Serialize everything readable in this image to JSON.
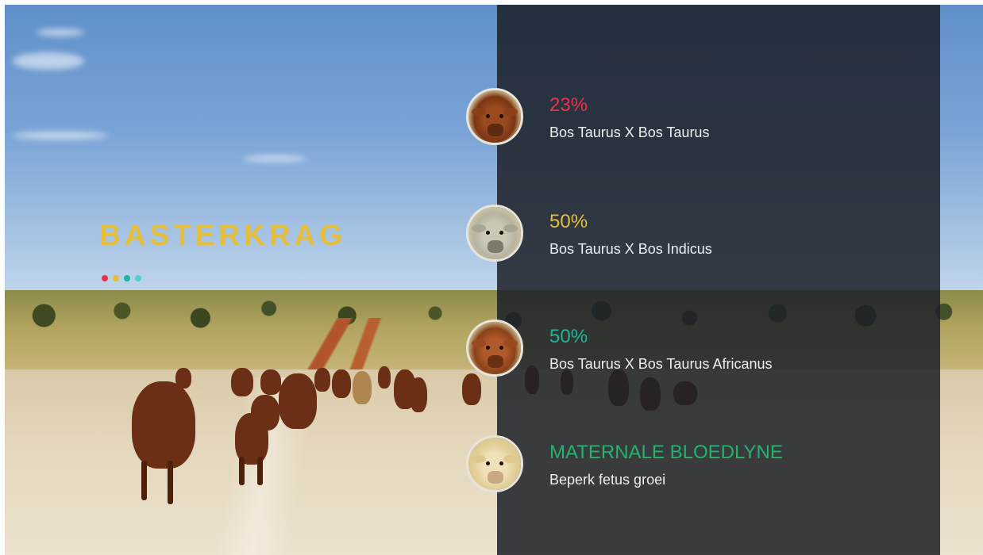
{
  "title": "BASTERKRAG",
  "dot_colors": [
    "#e8334f",
    "#e5bf3c",
    "#1fb39b",
    "#4dd2cf"
  ],
  "features": [
    {
      "value": "23%",
      "description": "Bos Taurus X  Bos Taurus",
      "color": "#e8334f",
      "avatar_icon": "red-cow-icon"
    },
    {
      "value": "50%",
      "description": "Bos Taurus X Bos Indicus",
      "color": "#e5bf3c",
      "avatar_icon": "grey-cow-icon"
    },
    {
      "value": "50%",
      "description": "Bos Taurus X Bos Taurus Africanus",
      "color": "#1fb39b",
      "avatar_icon": "brown-cow-icon"
    },
    {
      "value": "MATERNALE BLOEDLYNE",
      "description": "Beperk fetus groei",
      "color": "#23b36b",
      "avatar_icon": "cream-cow-icon"
    }
  ]
}
